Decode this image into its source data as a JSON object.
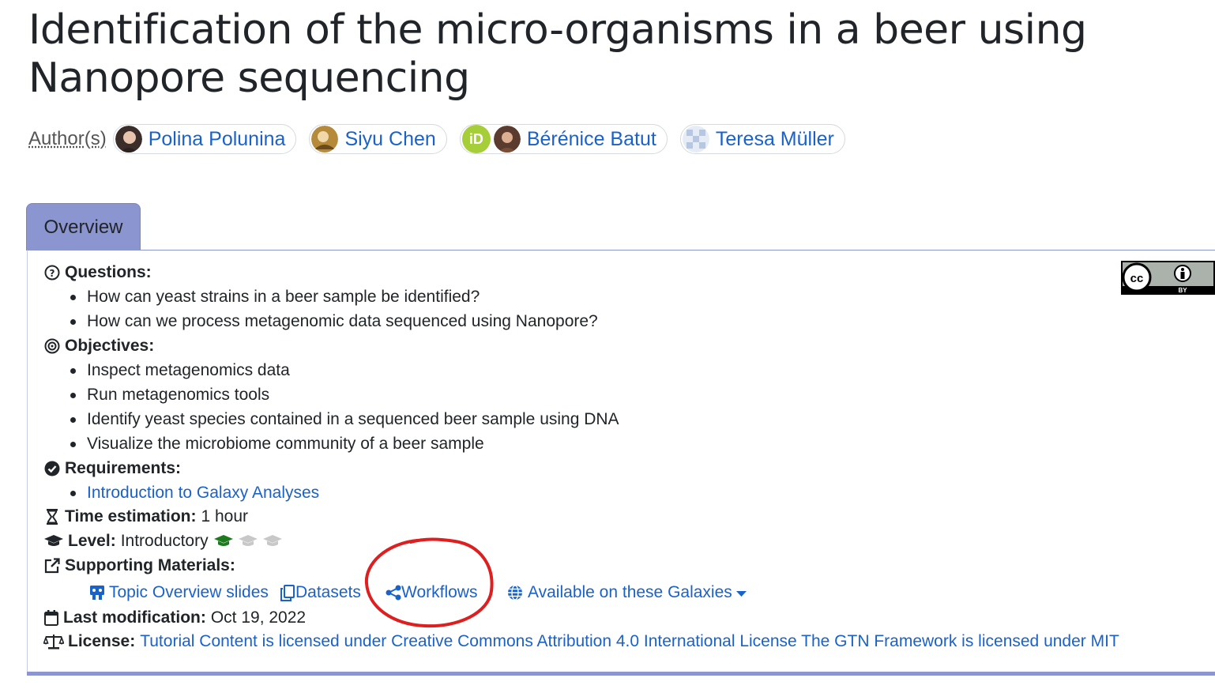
{
  "title": "Identification of the micro-organisms in a beer using Nanopore sequencing",
  "authors": {
    "label": "Author(s)",
    "list": [
      {
        "name": "Polina Polunina"
      },
      {
        "name": "Siyu Chen"
      },
      {
        "name": "Bérénice Batut"
      },
      {
        "name": "Teresa Müller"
      }
    ]
  },
  "tab": {
    "label": "Overview"
  },
  "questions": {
    "label": "Questions:",
    "items": [
      "How can yeast strains in a beer sample be identified?",
      "How can we process metagenomic data sequenced using Nanopore?"
    ]
  },
  "objectives": {
    "label": "Objectives:",
    "items": [
      "Inspect metagenomics data",
      "Run metagenomics tools",
      "Identify yeast species contained in a sequenced beer sample using DNA",
      "Visualize the microbiome community of a beer sample"
    ]
  },
  "requirements": {
    "label": "Requirements:",
    "items": [
      "Introduction to Galaxy Analyses"
    ]
  },
  "time": {
    "label": "Time estimation:",
    "value": "1 hour"
  },
  "level": {
    "label": "Level:",
    "value": "Introductory",
    "filled": 1,
    "total": 3
  },
  "supporting": {
    "label": "Supporting Materials:",
    "slides": "Topic Overview slides",
    "datasets": "Datasets",
    "workflows": "Workflows",
    "galaxies": "Available on these Galaxies"
  },
  "modification": {
    "label": "Last modification:",
    "value": "Oct 19, 2022"
  },
  "license": {
    "label": "License:",
    "value": "Tutorial Content is licensed under Creative Commons Attribution 4.0 International License The GTN Framework is licensed under MIT"
  },
  "cc_badge": {
    "text": "BY"
  },
  "colors": {
    "link": "#1a62c8",
    "tab": "#8b95cf",
    "level_filled": "#1e7a1e",
    "level_empty": "#c8c8c8",
    "annotation": "#dd1f1f"
  }
}
